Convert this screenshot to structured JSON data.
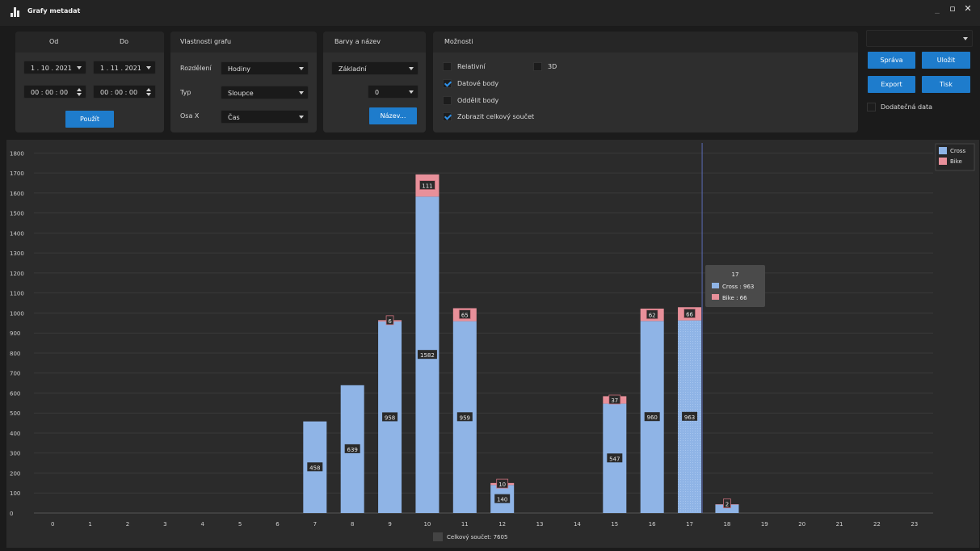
{
  "window": {
    "title": "Grafy metadat",
    "minimize": "_",
    "maximize": "▫",
    "close": "✕"
  },
  "date_panel": {
    "from_header": "Od",
    "to_header": "Do",
    "from_date": "1 . 10 . 2021",
    "to_date": "1 . 11 . 2021",
    "from_time": "00 : 00 : 00",
    "to_time": "00 : 00 : 00",
    "apply_button": "Použít"
  },
  "graph_props": {
    "title": "Vlastnosti grafu",
    "split_label": "Rozdělení",
    "split_value": "Hodiny",
    "type_label": "Typ",
    "type_value": "Sloupce",
    "xaxis_label": "Osa X",
    "xaxis_value": "Čas"
  },
  "colors_panel": {
    "title": "Barvy a název",
    "palette_value": "Základní",
    "index_value": "0",
    "name_button": "Název..."
  },
  "options_panel": {
    "title": "Možnosti",
    "relative": {
      "label": "Relativní",
      "checked": false
    },
    "three_d": {
      "label": "3D",
      "checked": false
    },
    "data_points": {
      "label": "Datové body",
      "checked": true
    },
    "separate_points": {
      "label": "Oddělit body",
      "checked": false
    },
    "show_total": {
      "label": "Zobrazit celkový součet",
      "checked": true
    }
  },
  "right_panel": {
    "select_value": "",
    "manage_button": "Správa",
    "save_button": "Uložit",
    "export_button": "Export",
    "print_button": "Tisk",
    "extra_data": {
      "label": "Dodatečná data",
      "checked": false
    }
  },
  "tooltip": {
    "title": "17",
    "cross_line": "Cross : 963",
    "bike_line": "Bike : 66"
  },
  "total_label": "Celkový součet: 7605",
  "colors": {
    "cross": "#8fb4e6",
    "bike": "#e8909a",
    "accent": "#1e7ccc",
    "marker": "#5a6bb3"
  },
  "chart_data": {
    "type": "bar",
    "stacked": true,
    "categories": [
      "0",
      "1",
      "2",
      "3",
      "4",
      "5",
      "6",
      "7",
      "8",
      "9",
      "10",
      "11",
      "12",
      "13",
      "14",
      "15",
      "16",
      "17",
      "18",
      "19",
      "20",
      "21",
      "22",
      "23"
    ],
    "series": [
      {
        "name": "Cross",
        "values": [
          0,
          0,
          0,
          0,
          0,
          0,
          0,
          458,
          639,
          958,
          1582,
          959,
          140,
          0,
          0,
          547,
          960,
          963,
          42,
          0,
          0,
          0,
          0,
          0
        ]
      },
      {
        "name": "Bike",
        "values": [
          0,
          0,
          0,
          0,
          0,
          0,
          0,
          0,
          0,
          6,
          111,
          65,
          10,
          0,
          0,
          37,
          62,
          66,
          2,
          0,
          0,
          0,
          0,
          0
        ]
      }
    ],
    "labels_shown": {
      "Cross": [
        null,
        null,
        null,
        null,
        null,
        null,
        null,
        "458",
        "639",
        "958",
        "1582",
        "959",
        "140",
        null,
        null,
        "547",
        "960",
        "963",
        null,
        null,
        null,
        null,
        null,
        null
      ],
      "Bike": [
        null,
        null,
        null,
        null,
        null,
        null,
        null,
        null,
        null,
        "6",
        "111",
        "65",
        "10",
        null,
        null,
        "37",
        "62",
        "66",
        "2",
        null,
        null,
        null,
        null,
        null
      ]
    },
    "ylim": [
      0,
      1850
    ],
    "yticks": [
      "0",
      "100",
      "200",
      "300",
      "400",
      "500",
      "600",
      "700",
      "800",
      "900",
      "1000",
      "1100",
      "1200",
      "1300",
      "1400",
      "1500",
      "1600",
      "1700",
      "1800"
    ],
    "grid": true,
    "legend": [
      "Cross",
      "Bike"
    ],
    "legend_position": "top-right",
    "highlight_category": "17"
  }
}
